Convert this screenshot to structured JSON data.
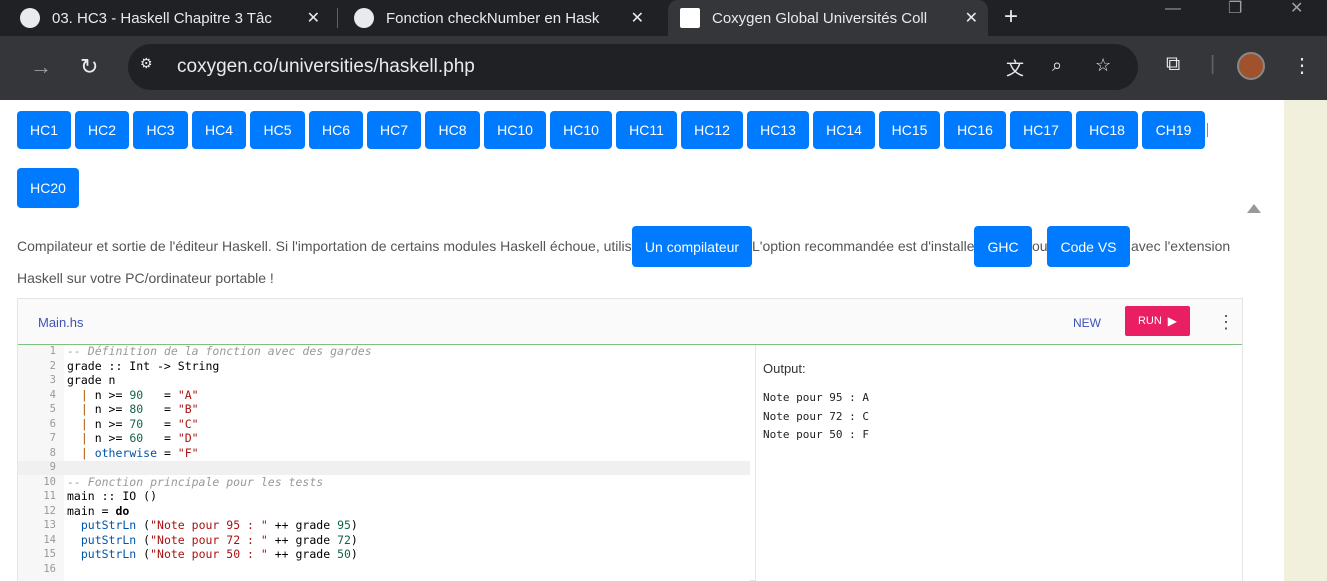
{
  "browser": {
    "tabs": [
      {
        "title": "03. HC3 - Haskell Chapitre 3 Tâc",
        "icon": "github-icon"
      },
      {
        "title": "Fonction checkNumber en Hask",
        "icon": "openai-icon"
      },
      {
        "title": "Coxygen Global Universités Coll",
        "icon": "coxygen-icon",
        "active": true
      }
    ],
    "new_tab": "+",
    "url": "coxygen.co/universities/haskell.php"
  },
  "page": {
    "hc_buttons": [
      "HC1",
      "HC2",
      "HC3",
      "HC4",
      "HC5",
      "HC6",
      "HC7",
      "HC8",
      "HC10",
      "HC10",
      "HC11",
      "HC12",
      "HC13",
      "HC14",
      "HC15",
      "HC16",
      "HC17",
      "HC18",
      "CH19",
      "HC20"
    ],
    "intro_1": "Compilateur et sortie de l'éditeur Haskell. Si l'importation de certains modules Haskell échoue, utilisez",
    "compiler_button": "Un compilateur",
    "intro_2": "L'option recommandée est d'installer",
    "ghc_button": "GHC",
    "intro_3": "ou",
    "codevs_button": "Code VS",
    "intro_4": "avec l'extension",
    "intro_5": "Haskell sur votre PC/ordinateur portable !"
  },
  "editor": {
    "file_tab": "Main.hs",
    "new_label": "NEW",
    "run_label": "RUN",
    "line_numbers": [
      "1",
      "2",
      "3",
      "4",
      "5",
      "6",
      "7",
      "8",
      "9",
      "10",
      "11",
      "12",
      "13",
      "14",
      "15",
      "16"
    ],
    "output_label": "Output:",
    "output_lines": [
      "Note pour 95 : A",
      "Note pour 72 : C",
      "Note pour 50 : F"
    ]
  },
  "code": {
    "l1": "-- Définition de la fonction avec des gardes",
    "l2": "grade :: Int -> String",
    "l3": "grade n",
    "l4a": "  | ",
    "l4b": "n >= ",
    "l4c": "90",
    "l4d": "   = ",
    "l4e": "\"A\"",
    "l5a": "  | ",
    "l5b": "n >= ",
    "l5c": "80",
    "l5d": "   = ",
    "l5e": "\"B\"",
    "l6a": "  | ",
    "l6b": "n >= ",
    "l6c": "70",
    "l6d": "   = ",
    "l6e": "\"C\"",
    "l7a": "  | ",
    "l7b": "n >= ",
    "l7c": "60",
    "l7d": "   = ",
    "l7e": "\"D\"",
    "l8a": "  | ",
    "l8b": "otherwise",
    "l8d": " = ",
    "l8e": "\"F\"",
    "l10": "-- Fonction principale pour les tests",
    "l11": "main :: IO ()",
    "l12a": "main = ",
    "l12b": "do",
    "l13a": "  putStrLn",
    "l13b": " (",
    "l13c": "\"Note pour 95 : \"",
    "l13d": " ++ grade ",
    "l13e": "95",
    "l13f": ")",
    "l14a": "  putStrLn",
    "l14b": " (",
    "l14c": "\"Note pour 72 : \"",
    "l14d": " ++ grade ",
    "l14e": "72",
    "l14f": ")",
    "l15a": "  putStrLn",
    "l15b": " (",
    "l15c": "\"Note pour 50 : \"",
    "l15d": " ++ grade ",
    "l15e": "50",
    "l15f": ")"
  }
}
